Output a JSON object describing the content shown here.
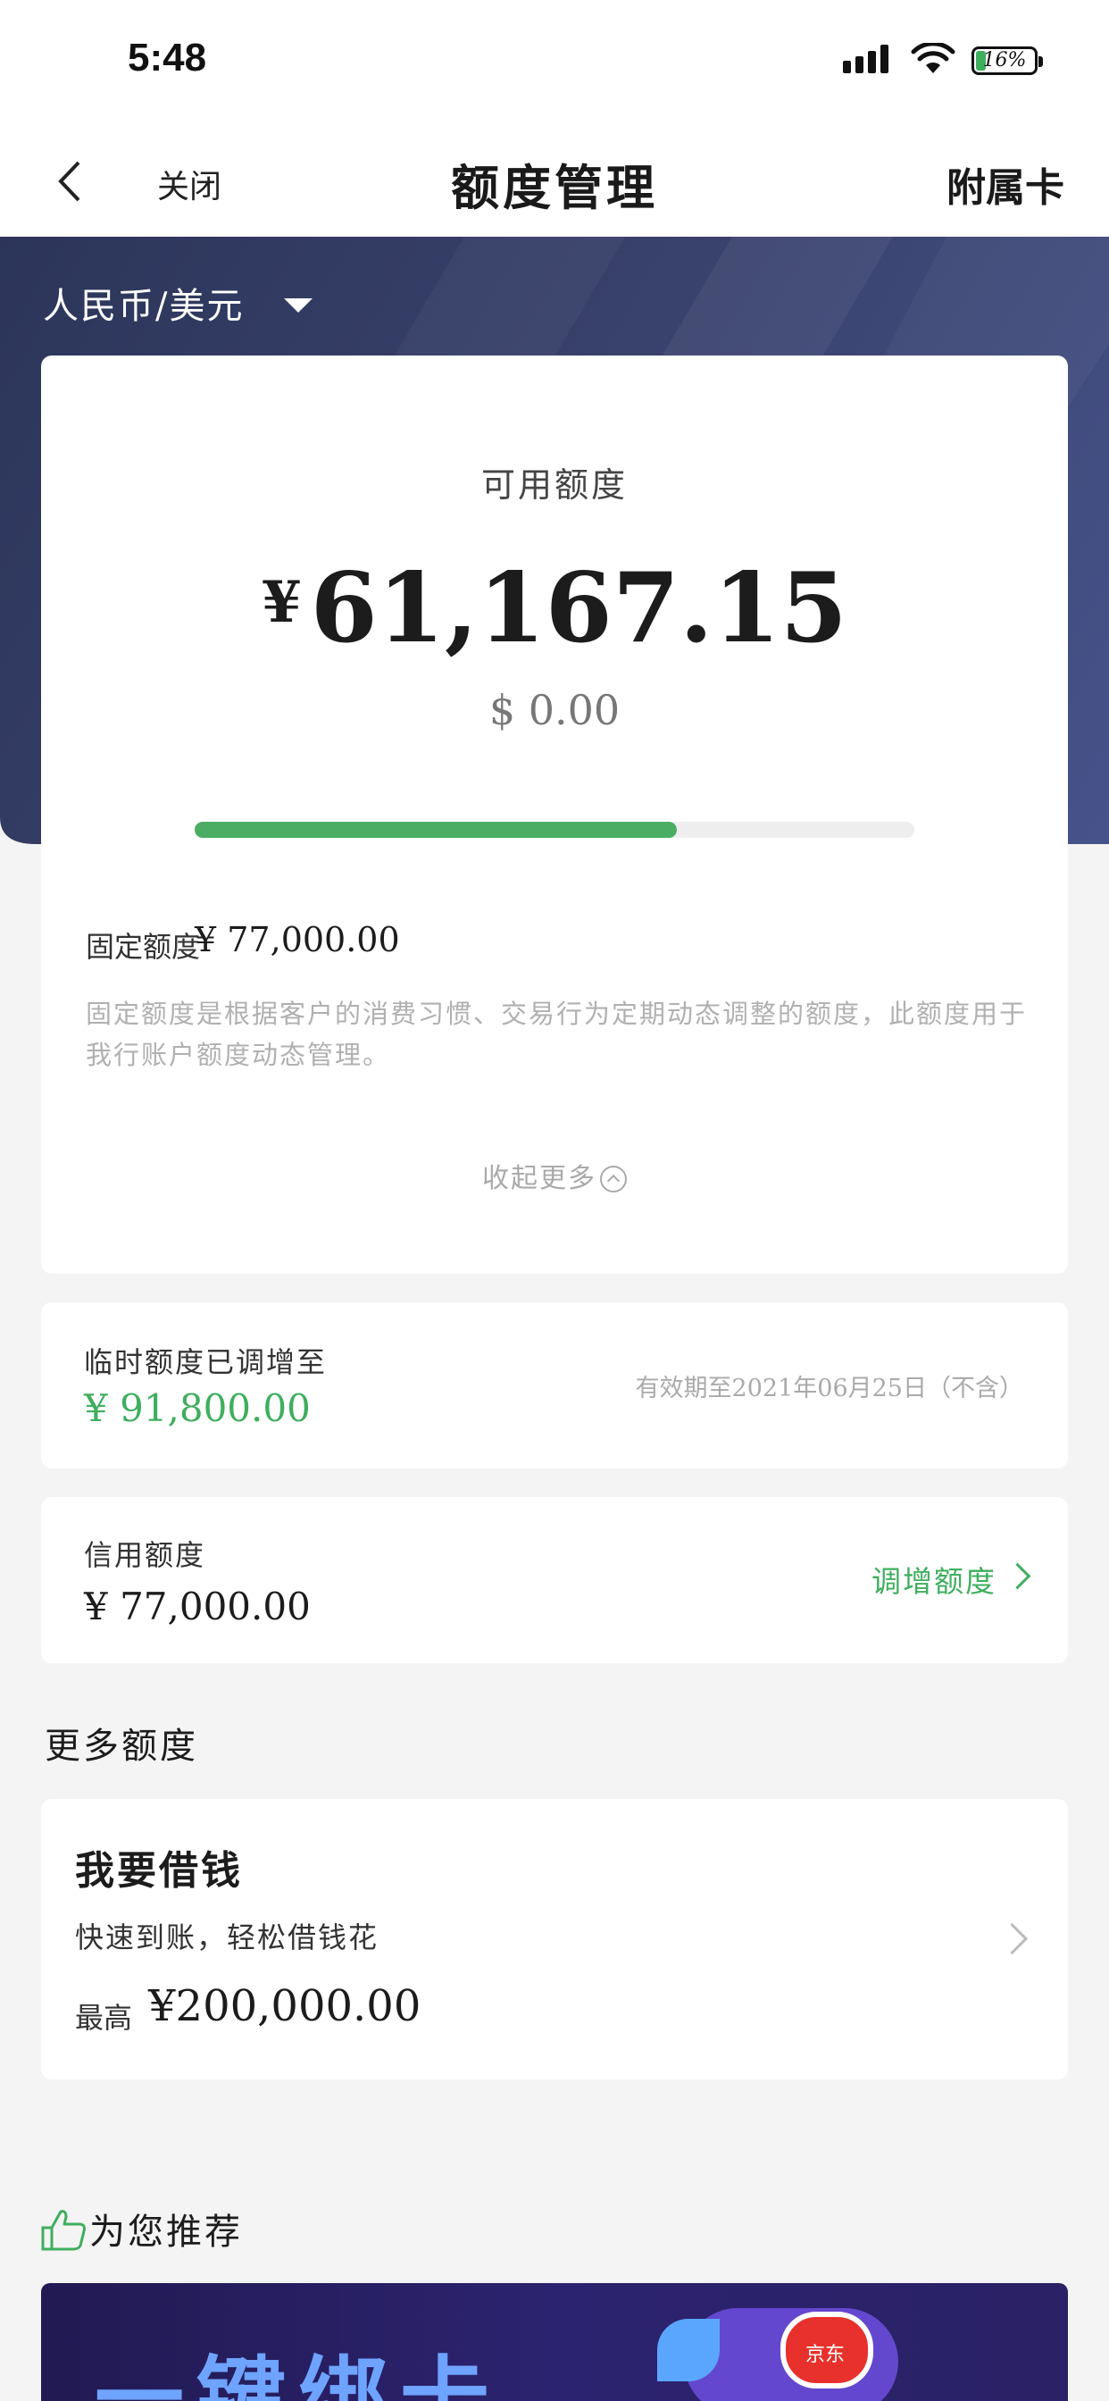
{
  "status_bar": {
    "time": "5:48",
    "battery": "16%"
  },
  "nav": {
    "close": "关闭",
    "title": "额度管理",
    "supplementary_card": "附属卡"
  },
  "currency": {
    "selected": "人民币/美元"
  },
  "available": {
    "label": "可用额度",
    "currency_symbol": "¥",
    "amount": "61,167.15",
    "usd": "$ 0.00",
    "usage_fraction": 0.67
  },
  "fixed": {
    "label": "固定额度",
    "amount": "¥ 77,000.00",
    "description": "固定额度是根据客户的消费习惯、交易行为定期动态调整的额度，此额度用于我行账户额度动态管理。",
    "collapse_label": "收起更多"
  },
  "temporary": {
    "label": "临时额度已调增至",
    "amount": "¥ 91,800.00",
    "validity": "有效期至2021年06月25日（不含）"
  },
  "credit": {
    "label": "信用额度",
    "amount": "¥ 77,000.00",
    "adjust_label": "调增额度"
  },
  "more": {
    "title": "更多额度",
    "borrow": {
      "title": "我要借钱",
      "subtitle": "快速到账，轻松借钱花",
      "max_label": "最高",
      "max_amount": "¥200,000.00"
    }
  },
  "recommend": {
    "title": "为您推荐",
    "banner_text": "一键绑卡",
    "banner_logo_text": "京东"
  },
  "colors": {
    "accent_green": "#3fae5e",
    "header_navy": "#38416a"
  }
}
